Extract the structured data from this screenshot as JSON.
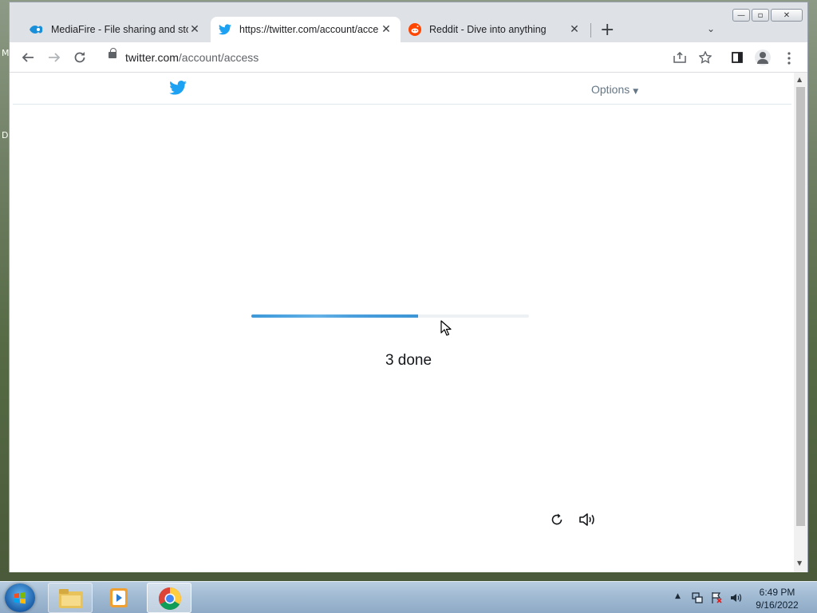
{
  "desktop": {
    "left_letters": [
      "M",
      "D"
    ]
  },
  "window": {
    "controls": {
      "minimize": "—",
      "maximize": "▫",
      "close": "✕"
    }
  },
  "tabs": [
    {
      "title": "MediaFire - File sharing and stora",
      "favicon": "mediafire-icon",
      "close": "✕"
    },
    {
      "title": "https://twitter.com/account/acce",
      "favicon": "twitter-bird-icon",
      "close": "✕"
    },
    {
      "title": "Reddit - Dive into anything",
      "favicon": "reddit-icon",
      "close": "✕"
    }
  ],
  "new_tab": "+",
  "tab_search": "⌄",
  "address_bar": {
    "host": "twitter.com",
    "path": "/account/access"
  },
  "page": {
    "options_label": "Options",
    "progress_fraction": 0.6,
    "status_text": "3 done",
    "icons": [
      "reload-icon",
      "audio-icon"
    ]
  },
  "taskbar": {
    "apps": [
      "explorer-icon",
      "media-player-icon",
      "chrome-icon"
    ],
    "clock_time": "6:49 PM",
    "clock_date": "9/16/2022"
  },
  "colors": {
    "twitter_blue": "#1da1f2",
    "progress_blue": "#3d98d8"
  }
}
